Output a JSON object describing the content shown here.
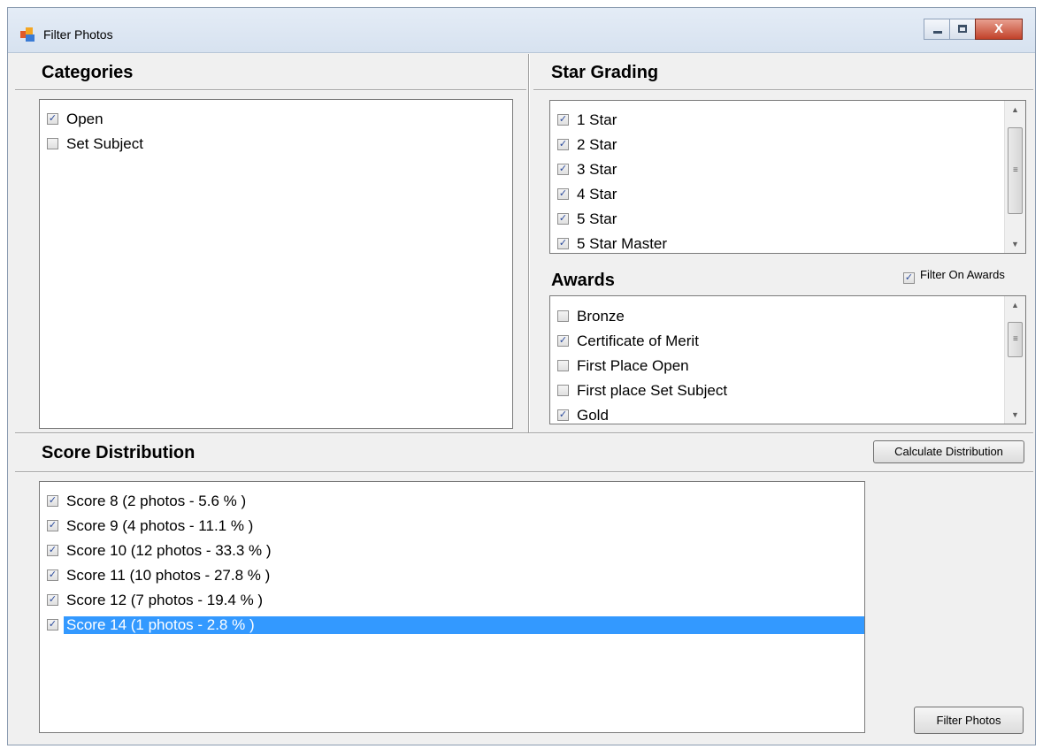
{
  "window": {
    "title": "Filter Photos",
    "controls": {
      "minimize": "minimize",
      "maximize": "maximize",
      "close": "X"
    }
  },
  "categories": {
    "header": "Categories",
    "items": [
      {
        "label": "Open",
        "checked": true
      },
      {
        "label": "Set Subject",
        "checked": false
      }
    ]
  },
  "star_grading": {
    "header": "Star Grading",
    "items": [
      {
        "label": "1 Star",
        "checked": true
      },
      {
        "label": "2 Star",
        "checked": true
      },
      {
        "label": "3 Star",
        "checked": true
      },
      {
        "label": "4 Star",
        "checked": true
      },
      {
        "label": "5 Star",
        "checked": true
      },
      {
        "label": "5 Star Master",
        "checked": true
      }
    ]
  },
  "awards": {
    "header": "Awards",
    "filter_label": "Filter On Awards",
    "filter_checked": true,
    "items": [
      {
        "label": "Bronze",
        "checked": false
      },
      {
        "label": "Certificate of Merit",
        "checked": true
      },
      {
        "label": "First Place Open",
        "checked": false
      },
      {
        "label": "First place Set Subject",
        "checked": false
      },
      {
        "label": "Gold",
        "checked": true
      }
    ]
  },
  "score_distribution": {
    "header": "Score Distribution",
    "calculate_button": "Calculate Distribution",
    "items": [
      {
        "label": "Score 8 (2 photos - 5.6 % )",
        "checked": true,
        "selected": false
      },
      {
        "label": "Score 9 (4 photos - 11.1 % )",
        "checked": true,
        "selected": false
      },
      {
        "label": "Score 10 (12 photos - 33.3 % )",
        "checked": true,
        "selected": false
      },
      {
        "label": "Score 11 (10 photos - 27.8 % )",
        "checked": true,
        "selected": false
      },
      {
        "label": "Score 12 (7 photos - 19.4 % )",
        "checked": true,
        "selected": false
      },
      {
        "label": "Score 14 (1 photos - 2.8 % )",
        "checked": true,
        "selected": true
      }
    ]
  },
  "filter_button": "Filter Photos",
  "colors": {
    "selection": "#3399ff",
    "checkmark": "#2b4a9b",
    "window_bg": "#f0f0f0"
  },
  "check_glyph": "✓"
}
